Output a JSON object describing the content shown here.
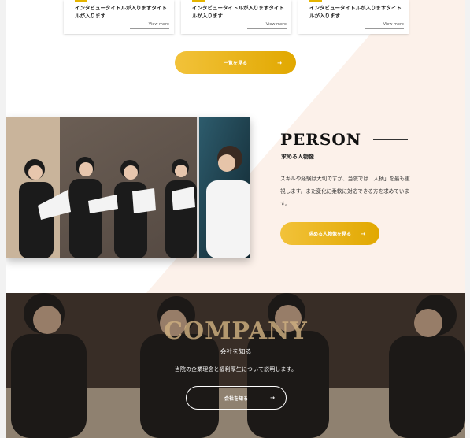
{
  "interviews": {
    "cards": [
      {
        "title": "インタビュータイトルが入りますタイトルが入ります",
        "more": "View more"
      },
      {
        "title": "インタビュータイトルが入りますタイトルが入ります",
        "more": "View more"
      },
      {
        "title": "インタビュータイトルが入りますタイトルが入ります",
        "more": "View more"
      }
    ],
    "list_button": "一覧を見る"
  },
  "person": {
    "title": "PERSON",
    "subtitle": "求める人物像",
    "description": "スキルや経験は大切ですが、当院では「人柄」を最も重視します。また変化に柔軟に対応できる方を求めています。",
    "button": "求める人物像を見る"
  },
  "company": {
    "title": "COMPANY",
    "subtitle": "会社を知る",
    "description": "当院の企業理念と福利厚生について説明します。",
    "button": "会社を知る"
  },
  "colors": {
    "accent": "#e5b400",
    "diag_bg": "#fcf1ea"
  }
}
